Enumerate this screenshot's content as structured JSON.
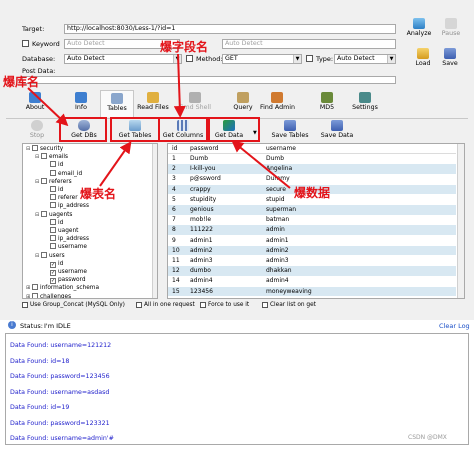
{
  "form": {
    "target_label": "Target:",
    "target_value": "http://localhost:8030/Less-1/?id=1",
    "keyword_label": "Keyword",
    "keyword_value": "Auto Detect",
    "keyword2_value": "Auto Detect",
    "database_label": "Database:",
    "database_value": "Auto Detect",
    "method_label": "Method:",
    "method_value": "GET",
    "type_label": "Type:",
    "type_value": "Auto Detect",
    "postdata_label": "Post Data:"
  },
  "right_buttons": {
    "analyze": "Analyze",
    "pause": "Pause",
    "load": "Load",
    "save": "Save"
  },
  "tabs": [
    "About",
    "Info",
    "Tables",
    "Read Files",
    "Cmd Shell",
    "Query",
    "Find Admin",
    "MD5",
    "Settings"
  ],
  "toolbar": {
    "stop": "Stop",
    "get_dbs": "Get DBs",
    "get_tables": "Get Tables",
    "get_columns": "Get Columns",
    "get_data": "Get Data",
    "save_tables": "Save Tables",
    "save_data": "Save Data"
  },
  "annotations": {
    "db_name": "爆库名",
    "table_name": "爆表名",
    "column_name": "爆字段名",
    "data": "爆数据"
  },
  "tree": [
    {
      "indent": 0,
      "label": "security",
      "checked": false,
      "exp": "⊟"
    },
    {
      "indent": 1,
      "label": "emails",
      "checked": false,
      "exp": "⊟"
    },
    {
      "indent": 2,
      "label": "id",
      "checked": false,
      "exp": ""
    },
    {
      "indent": 2,
      "label": "email_id",
      "checked": false,
      "exp": ""
    },
    {
      "indent": 1,
      "label": "referers",
      "checked": false,
      "exp": "⊟"
    },
    {
      "indent": 2,
      "label": "id",
      "checked": false,
      "exp": ""
    },
    {
      "indent": 2,
      "label": "referer",
      "checked": false,
      "exp": ""
    },
    {
      "indent": 2,
      "label": "ip_address",
      "checked": false,
      "exp": ""
    },
    {
      "indent": 1,
      "label": "uagents",
      "checked": false,
      "exp": "⊟"
    },
    {
      "indent": 2,
      "label": "id",
      "checked": false,
      "exp": ""
    },
    {
      "indent": 2,
      "label": "uagent",
      "checked": false,
      "exp": ""
    },
    {
      "indent": 2,
      "label": "ip_address",
      "checked": false,
      "exp": ""
    },
    {
      "indent": 2,
      "label": "username",
      "checked": false,
      "exp": ""
    },
    {
      "indent": 1,
      "label": "users",
      "checked": false,
      "exp": "⊟"
    },
    {
      "indent": 2,
      "label": "id",
      "checked": true,
      "exp": ""
    },
    {
      "indent": 2,
      "label": "username",
      "checked": true,
      "exp": ""
    },
    {
      "indent": 2,
      "label": "password",
      "checked": true,
      "exp": ""
    },
    {
      "indent": 0,
      "label": "information_schema",
      "checked": false,
      "exp": "⊞"
    },
    {
      "indent": 0,
      "label": "challenges",
      "checked": false,
      "exp": "⊞"
    }
  ],
  "grid": {
    "headers": [
      "id",
      "password",
      "username"
    ],
    "rows": [
      [
        "1",
        "Dumb",
        "Dumb"
      ],
      [
        "2",
        "I-kill-you",
        "Angelina"
      ],
      [
        "3",
        "p@ssword",
        "Dummy"
      ],
      [
        "4",
        "crappy",
        "secure"
      ],
      [
        "5",
        "stupidity",
        "stupid"
      ],
      [
        "6",
        "genious",
        "superman"
      ],
      [
        "7",
        "mob!le",
        "batman"
      ],
      [
        "8",
        "111222",
        "admin"
      ],
      [
        "9",
        "admin1",
        "admin1"
      ],
      [
        "10",
        "admin2",
        "admin2"
      ],
      [
        "11",
        "admin3",
        "admin3"
      ],
      [
        "12",
        "dumbo",
        "dhakkan"
      ],
      [
        "14",
        "admin4",
        "admin4"
      ],
      [
        "15",
        "123456",
        "moneyweaving"
      ]
    ]
  },
  "options": {
    "group_concat": "Use Group_Concat (MySQL Only)",
    "all_in_one": "All in one request",
    "force": "Force to use it",
    "clear_list": "Clear list on get"
  },
  "status": {
    "label": "Status:",
    "value": "I'm IDLE",
    "clear_log": "Clear Log"
  },
  "log": [
    "Data Found: username=121212",
    "Data Found: id=18",
    "Data Found: password=123456",
    "Data Found: username=asdasd",
    "Data Found: id=19",
    "Data Found: password=123321",
    "Data Found: username=admin'#"
  ],
  "watermark": "CSDN @DMX",
  "colors": {
    "annotation_red": "#e3141a",
    "log_text": "#2222cc",
    "grid_alt_row": "#d8e8f2"
  }
}
